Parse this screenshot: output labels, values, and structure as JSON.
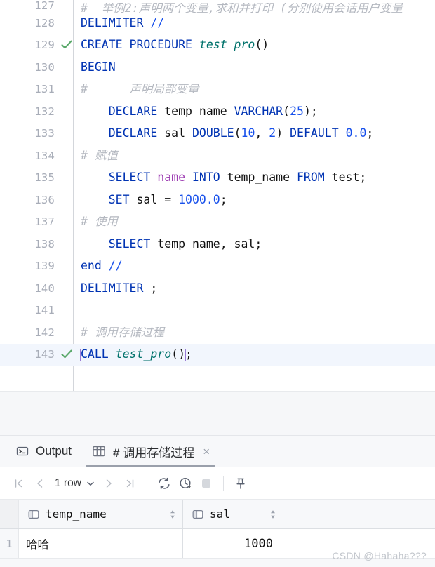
{
  "editor": {
    "lines": [
      {
        "number": "127",
        "mark": "",
        "partial": true,
        "tokens": [
          {
            "t": "cmt",
            "s": "#  举例2:声明两个变量,求和并打印 (分别使用会话用户变量"
          }
        ]
      },
      {
        "number": "128",
        "mark": "",
        "tokens": [
          {
            "t": "kw",
            "s": "DELIMITER "
          },
          {
            "t": "num",
            "s": "//"
          }
        ]
      },
      {
        "number": "129",
        "mark": "check",
        "tokens": [
          {
            "t": "kw",
            "s": "CREATE PROCEDURE "
          },
          {
            "t": "fn",
            "s": "test_pro"
          },
          {
            "t": "punc",
            "s": "()"
          }
        ]
      },
      {
        "number": "130",
        "mark": "",
        "tokens": [
          {
            "t": "kw",
            "s": "BEGIN"
          }
        ]
      },
      {
        "number": "131",
        "mark": "",
        "tokens": [
          {
            "t": "cmt",
            "s": "#      声明局部变量"
          }
        ]
      },
      {
        "number": "132",
        "mark": "",
        "tokens": [
          {
            "t": "id",
            "s": "    "
          },
          {
            "t": "kw",
            "s": "DECLARE "
          },
          {
            "t": "id",
            "s": "temp_name "
          },
          {
            "t": "kw",
            "s": "VARCHAR"
          },
          {
            "t": "punc",
            "s": "("
          },
          {
            "t": "num",
            "s": "25"
          },
          {
            "t": "punc",
            "s": ");"
          }
        ]
      },
      {
        "number": "133",
        "mark": "",
        "tokens": [
          {
            "t": "id",
            "s": "    "
          },
          {
            "t": "kw",
            "s": "DECLARE "
          },
          {
            "t": "id",
            "s": "sal "
          },
          {
            "t": "kw",
            "s": "DOUBLE"
          },
          {
            "t": "punc",
            "s": "("
          },
          {
            "t": "num",
            "s": "10"
          },
          {
            "t": "punc",
            "s": ", "
          },
          {
            "t": "num",
            "s": "2"
          },
          {
            "t": "punc",
            "s": ") "
          },
          {
            "t": "kw",
            "s": "DEFAULT "
          },
          {
            "t": "num",
            "s": "0.0"
          },
          {
            "t": "punc",
            "s": ";"
          }
        ]
      },
      {
        "number": "134",
        "mark": "",
        "tokens": [
          {
            "t": "cmt",
            "s": "# 赋值"
          }
        ]
      },
      {
        "number": "135",
        "mark": "",
        "tokens": [
          {
            "t": "id",
            "s": "    "
          },
          {
            "t": "kw",
            "s": "SELECT "
          },
          {
            "t": "col",
            "s": "name "
          },
          {
            "t": "kw",
            "s": "INTO "
          },
          {
            "t": "id",
            "s": "temp_name "
          },
          {
            "t": "kw",
            "s": "FROM "
          },
          {
            "t": "id",
            "s": "test"
          },
          {
            "t": "punc",
            "s": ";"
          }
        ]
      },
      {
        "number": "136",
        "mark": "",
        "tokens": [
          {
            "t": "id",
            "s": "    "
          },
          {
            "t": "kw",
            "s": "SET "
          },
          {
            "t": "id",
            "s": "sal "
          },
          {
            "t": "punc",
            "s": "= "
          },
          {
            "t": "num",
            "s": "1000.0"
          },
          {
            "t": "punc",
            "s": ";"
          }
        ]
      },
      {
        "number": "137",
        "mark": "",
        "tokens": [
          {
            "t": "cmt",
            "s": "# 使用"
          }
        ]
      },
      {
        "number": "138",
        "mark": "",
        "tokens": [
          {
            "t": "id",
            "s": "    "
          },
          {
            "t": "kw",
            "s": "SELECT "
          },
          {
            "t": "id",
            "s": "temp_name, sal"
          },
          {
            "t": "punc",
            "s": ";"
          }
        ]
      },
      {
        "number": "139",
        "mark": "",
        "tokens": [
          {
            "t": "kw",
            "s": "end "
          },
          {
            "t": "num",
            "s": "//"
          }
        ]
      },
      {
        "number": "140",
        "mark": "",
        "tokens": [
          {
            "t": "kw",
            "s": "DELIMITER "
          },
          {
            "t": "punc",
            "s": ";"
          }
        ]
      },
      {
        "number": "141",
        "mark": "",
        "tokens": []
      },
      {
        "number": "142",
        "mark": "",
        "tokens": [
          {
            "t": "cmt",
            "s": "# 调用存储过程"
          }
        ]
      },
      {
        "number": "143",
        "mark": "check",
        "highlight": true,
        "selection": true,
        "tokens": [
          {
            "t": "kw",
            "s": "CALL "
          },
          {
            "t": "fn",
            "s": "test_pro"
          },
          {
            "t": "punc",
            "s": "()"
          }
        ],
        "after": ";"
      }
    ]
  },
  "panel": {
    "tabs": [
      {
        "label": "Output",
        "icon": "terminal-icon",
        "active": false,
        "closable": false
      },
      {
        "label": "# 调用存储过程",
        "icon": "table-grid-icon",
        "active": true,
        "closable": true,
        "close_label": "×"
      }
    ],
    "toolbar": {
      "first_page": "first-page-icon",
      "prev_page": "previous-page-icon",
      "row_count": "1 row",
      "dropdown": "chevron-down-icon",
      "next_page": "next-page-icon",
      "last_page": "last-page-icon",
      "refresh": "refresh-icon",
      "history": "history-clock-icon",
      "stop": "stop-icon",
      "pin": "pin-icon"
    },
    "grid": {
      "columns": [
        {
          "name": "temp_name",
          "icon": "column-icon",
          "sort": "sort-arrows-icon"
        },
        {
          "name": "sal",
          "icon": "column-icon",
          "sort": "sort-arrows-icon"
        }
      ],
      "rows": [
        {
          "index": "1",
          "temp_name": "哈哈",
          "sal": "1000"
        }
      ]
    }
  },
  "watermark": "CSDN @Hahaha???",
  "colors": {
    "keyword": "#0033b3",
    "function": "#00726b",
    "number": "#1750eb",
    "column": "#9e3eb3",
    "comment": "#b4b8c0",
    "check": "#59a869",
    "selection_border": "#9a7bd6",
    "highlight_row": "#f2f6fd"
  }
}
